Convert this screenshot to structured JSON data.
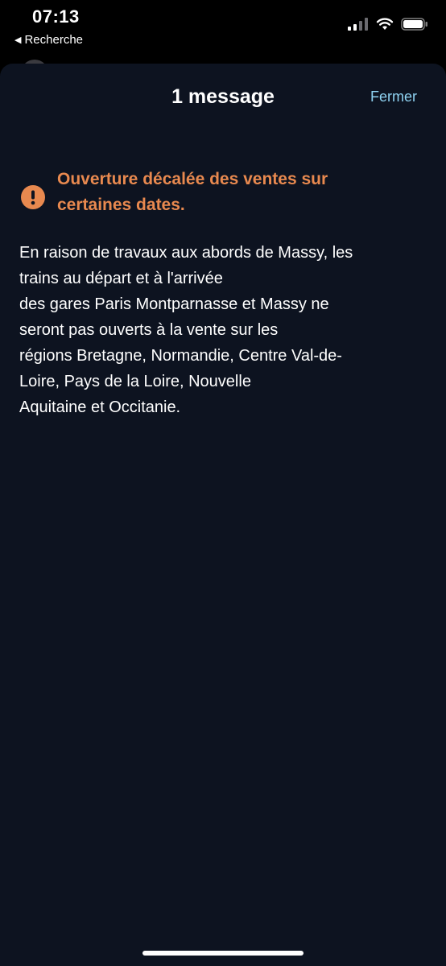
{
  "status_bar": {
    "time": "07:13",
    "back_label": "Recherche"
  },
  "sheet": {
    "title": "1 message",
    "close_label": "Fermer"
  },
  "message": {
    "title_lines": [
      "Ouverture décalée des ventes sur",
      "certaines dates."
    ],
    "body_lines": [
      "En raison de travaux aux abords de Massy, les",
      "trains au départ et à l'arrivée",
      "des gares Paris Montparnasse et Massy ne",
      "seront pas ouverts à la vente sur les",
      "régions Bretagne, Normandie, Centre Val-de-",
      "Loire, Pays de la Loire, Nouvelle",
      "Aquitaine et Occitanie."
    ]
  },
  "colors": {
    "background": "#000000",
    "sheet": "#0d1320",
    "accent": "#e8894f",
    "link": "#8fd3f2",
    "text": "#ffffff"
  },
  "icons": {
    "back": "back-arrow-icon",
    "signal": "cellular-signal-icon",
    "wifi": "wifi-icon",
    "battery": "battery-icon",
    "alert": "exclamation-circle-icon"
  }
}
